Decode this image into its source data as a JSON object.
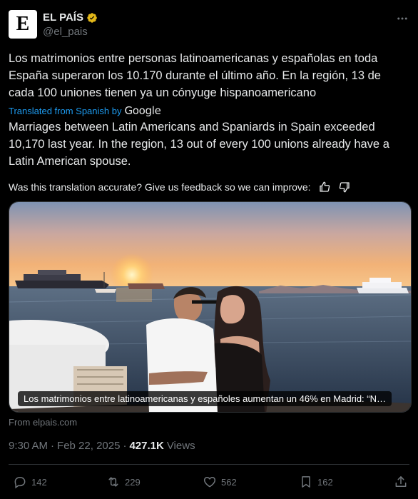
{
  "author": {
    "logo_letter": "E",
    "display_name": "EL PAÍS",
    "handle": "@el_pais"
  },
  "tweet": {
    "original_text": "Los matrimonios entre personas latinoamericanas y españolas en toda España superaron los 10.170 durante el último año. En la región, 13 de cada 100 uniones tienen ya un cónyuge hispanoamericano",
    "translated_label": "Translated from Spanish by",
    "translated_provider": "Google",
    "translated_text": "Marriages between Latin Americans and Spaniards in Spain exceeded 10,170 last year. In the region, 13 out of every 100 unions already have a Latin American spouse.",
    "feedback_prompt": "Was this translation accurate? Give us feedback so we can improve:"
  },
  "media": {
    "caption": "Los matrimonios entre latinoamericanas y españoles aumentan un 46% en Madrid: “N…",
    "source": "From elpais.com"
  },
  "meta": {
    "time": "9:30 AM",
    "separator": "·",
    "date": "Feb 22, 2025",
    "views_count": "427.1K",
    "views_label": "Views"
  },
  "actions": {
    "replies": "142",
    "reposts": "229",
    "likes": "562",
    "bookmarks": "162"
  },
  "colors": {
    "background": "#000000",
    "text": "#e7e9ea",
    "secondary": "#71767b",
    "link": "#1d9bf0",
    "verified": "#e2b719",
    "divider": "#2f3336"
  }
}
